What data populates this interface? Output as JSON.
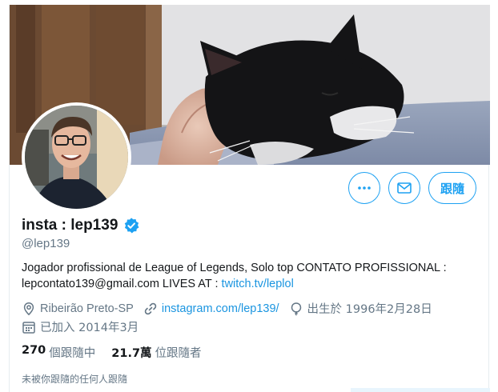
{
  "profile": {
    "display_name": "insta : lep139",
    "handle": "@lep139",
    "verified": true,
    "bio_text": "Jogador profissional de League of Legends, Solo top CONTATO PROFISSIONAL : lepcontato139@gmail.com LIVES AT : ",
    "bio_link": "twitch.tv/leplol",
    "location": "Ribeirão Preto-SP",
    "website": "instagram.com/lep139/",
    "birthday": "出生於 1996年2月28日",
    "joined": "已加入 2014年3月",
    "following_count": "270",
    "following_label": "個跟隨中",
    "followers_count": "21.7萬",
    "followers_label": "位跟隨者",
    "followers_you_know": "未被你跟隨的任何人跟隨"
  },
  "actions": {
    "more_icon": "more-dots-icon",
    "message_icon": "envelope-icon",
    "follow_label": "跟隨"
  },
  "colors": {
    "accent": "#1da1f2",
    "link": "#1b95e0",
    "muted": "#657786",
    "text": "#14171a"
  },
  "icons": {
    "verified": "verified-badge-icon",
    "location": "location-pin-icon",
    "website": "link-icon",
    "birthday": "balloon-icon",
    "joined": "calendar-icon"
  }
}
